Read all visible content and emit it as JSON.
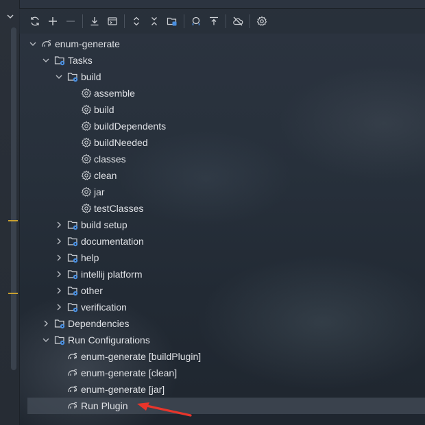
{
  "toolbar": {
    "buttons": [
      "reload-icon",
      "plus-icon",
      "minus-icon",
      "download-icon",
      "run-tasks-icon",
      "expand-all-icon",
      "collapse-all-icon",
      "project-folder-icon",
      "analyze-dependencies-icon",
      "collapse-tree-icon",
      "offline-mode-icon",
      "settings-icon"
    ]
  },
  "tree": {
    "project": "enum-generate",
    "tasks": "Tasks",
    "build_group": "build",
    "build_tasks": [
      "assemble",
      "build",
      "buildDependents",
      "buildNeeded",
      "classes",
      "clean",
      "jar",
      "testClasses"
    ],
    "groups": [
      "build setup",
      "documentation",
      "help",
      "intellij platform",
      "other",
      "verification"
    ],
    "dependencies": "Dependencies",
    "run_configurations": "Run Configurations",
    "configs": [
      "enum-generate [buildPlugin]",
      "enum-generate [clean]",
      "enum-generate [jar]",
      "Run Plugin"
    ]
  },
  "colors": {
    "background": "#27303b",
    "text": "#dfe1e5",
    "folder_badge": "#4a8fe0",
    "annotation_arrow": "#e8352b",
    "rail_marker": "#c8a030"
  }
}
